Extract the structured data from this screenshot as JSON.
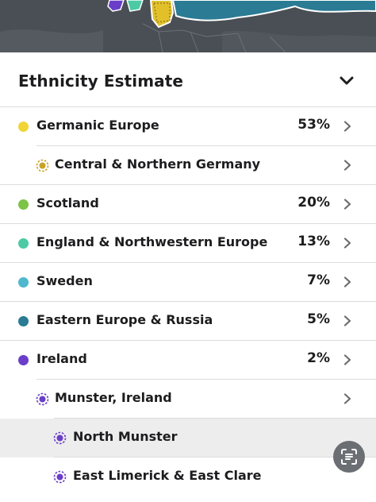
{
  "section": {
    "title": "Ethnicity Estimate"
  },
  "colors": {
    "germanic": "#f0d535",
    "scotland": "#7cc346",
    "england": "#4ccaa3",
    "sweden": "#4fb8cd",
    "eastern": "#2a7b93",
    "ireland": "#6a3ec9"
  },
  "regions": [
    {
      "name": "Germanic Europe",
      "percent": "53%",
      "color": "#f0d535",
      "icon": "dot-icon"
    },
    {
      "name": "Central & Northern Germany",
      "percent": "",
      "color": "#c9a227",
      "icon": "community-icon"
    },
    {
      "name": "Scotland",
      "percent": "20%",
      "color": "#7cc346",
      "icon": "dot-icon"
    },
    {
      "name": "England & Northwestern Europe",
      "percent": "13%",
      "color": "#4ccaa3",
      "icon": "dot-icon"
    },
    {
      "name": "Sweden",
      "percent": "7%",
      "color": "#4fb8cd",
      "icon": "dot-icon"
    },
    {
      "name": "Eastern Europe & Russia",
      "percent": "5%",
      "color": "#2a7b93",
      "icon": "dot-icon"
    },
    {
      "name": "Ireland",
      "percent": "2%",
      "color": "#6a3ec9",
      "icon": "dot-icon"
    },
    {
      "name": "Munster, Ireland",
      "percent": "",
      "color": "#6a3ec9",
      "icon": "community-icon"
    },
    {
      "name": "North Munster",
      "percent": "",
      "color": "#6a3ec9",
      "icon": "community-icon"
    },
    {
      "name": "East Limerick & East Clare",
      "percent": "",
      "color": "#6a3ec9",
      "icon": "community-icon"
    }
  ]
}
